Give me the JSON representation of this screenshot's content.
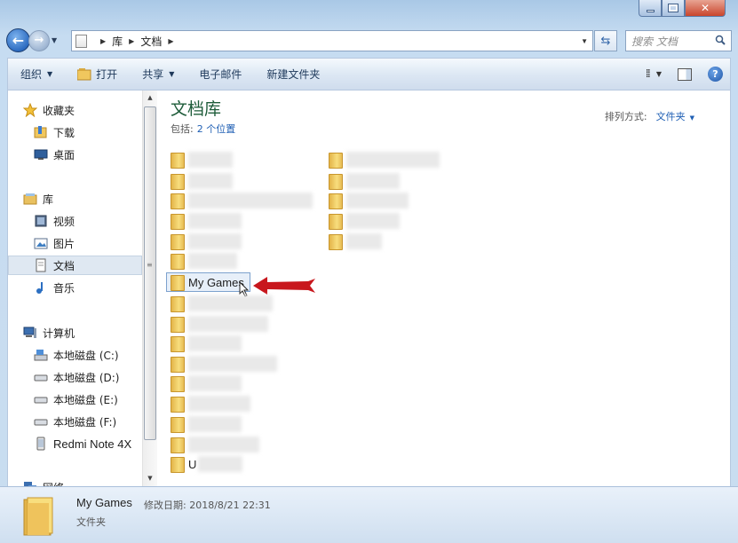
{
  "window": {
    "title": "文档"
  },
  "address": {
    "crumbs": [
      "库",
      "文档"
    ]
  },
  "search": {
    "placeholder": "搜索 文档"
  },
  "toolbar": {
    "organize": "组织",
    "open": "打开",
    "share": "共享",
    "email": "电子邮件",
    "new_folder": "新建文件夹"
  },
  "nav": {
    "favorites": "收藏夹",
    "downloads": "下载",
    "desktop": "桌面",
    "libraries": "库",
    "videos": "视频",
    "pictures": "图片",
    "documents": "文档",
    "music": "音乐",
    "computer": "计算机",
    "drives": [
      "本地磁盘 (C:)",
      "本地磁盘 (D:)",
      "本地磁盘 (E:)",
      "本地磁盘 (F:)"
    ],
    "phone": "Redmi Note 4X",
    "network": "网络"
  },
  "main": {
    "library_title": "文档库",
    "includes_label": "包括:",
    "includes_link": "2 个位置",
    "arrange_label": "排列方式:",
    "arrange_value": "文件夹",
    "selected_folder": "My Games",
    "partial_label": "U"
  },
  "details": {
    "name": "My Games",
    "modified": "修改日期: 2018/8/21 22:31",
    "type": "文件夹"
  },
  "colors": {
    "accent": "#1f5fb4",
    "title_green": "#1e5c3a",
    "arrow": "#c8171d"
  }
}
